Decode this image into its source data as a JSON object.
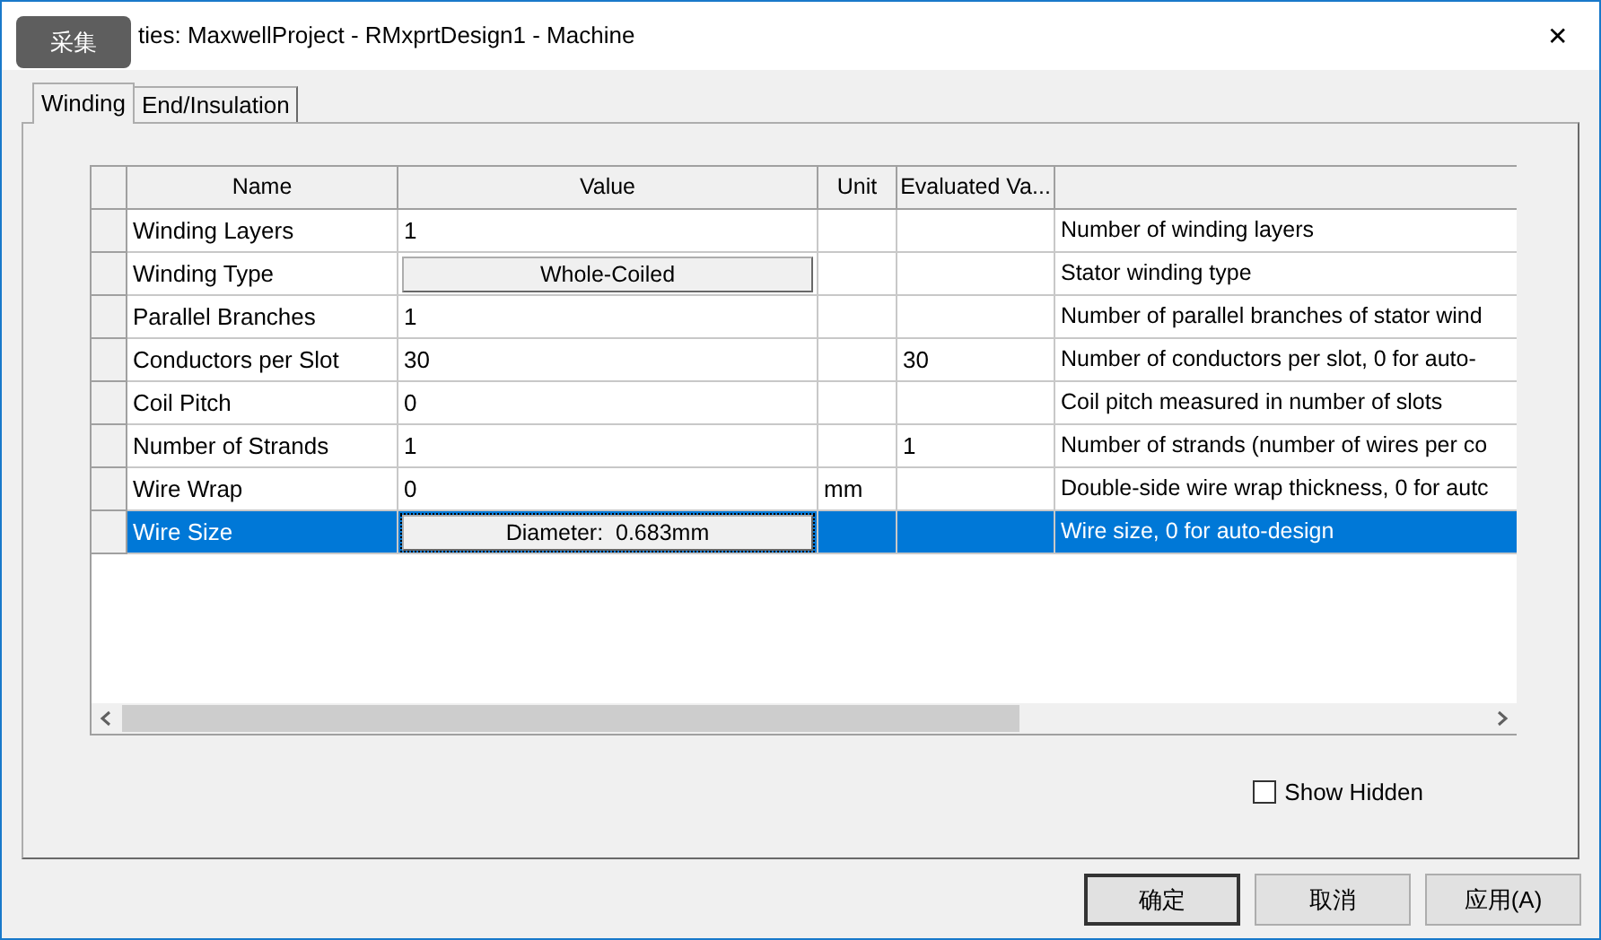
{
  "window": {
    "title": "ties: MaxwellProject - RMxprtDesign1 - Machine",
    "overlay_button": "采集",
    "close": "✕"
  },
  "tabs": [
    {
      "label": "Winding",
      "selected": true
    },
    {
      "label": "End/Insulation",
      "selected": false
    }
  ],
  "table": {
    "columns": [
      "Name",
      "Value",
      "Unit",
      "Evaluated Va..."
    ],
    "rows": [
      {
        "name": "Winding Layers",
        "value": "1",
        "kind": "text",
        "unit": "",
        "evaluated": "",
        "description": "Number of winding layers",
        "selected": false
      },
      {
        "name": "Winding Type",
        "value": "Whole-Coiled",
        "kind": "button",
        "unit": "",
        "evaluated": "",
        "description": "Stator winding type",
        "selected": false
      },
      {
        "name": "Parallel Branches",
        "value": "1",
        "kind": "text",
        "unit": "",
        "evaluated": "",
        "description": "Number of parallel branches of stator wind",
        "selected": false
      },
      {
        "name": "Conductors per Slot",
        "value": "30",
        "kind": "text",
        "unit": "",
        "evaluated": "30",
        "description": "Number of conductors per slot, 0 for auto-",
        "selected": false
      },
      {
        "name": "Coil Pitch",
        "value": "0",
        "kind": "text",
        "unit": "",
        "evaluated": "",
        "description": "Coil pitch measured in number of slots",
        "selected": false
      },
      {
        "name": "Number of Strands",
        "value": "1",
        "kind": "text",
        "unit": "",
        "evaluated": "1",
        "description": "Number of strands (number of wires per co",
        "selected": false
      },
      {
        "name": "Wire Wrap",
        "value": "0",
        "kind": "text",
        "unit": "mm",
        "evaluated": "",
        "description": "Double-side wire wrap thickness, 0 for autc",
        "selected": false
      },
      {
        "name": "Wire Size",
        "value": "Diameter:  0.683mm",
        "kind": "button",
        "unit": "",
        "evaluated": "",
        "description": "Wire size, 0 for auto-design",
        "selected": true
      }
    ]
  },
  "show_hidden": {
    "label": "Show Hidden",
    "checked": false
  },
  "buttons": [
    "确定",
    "取消",
    "应用(A)"
  ]
}
